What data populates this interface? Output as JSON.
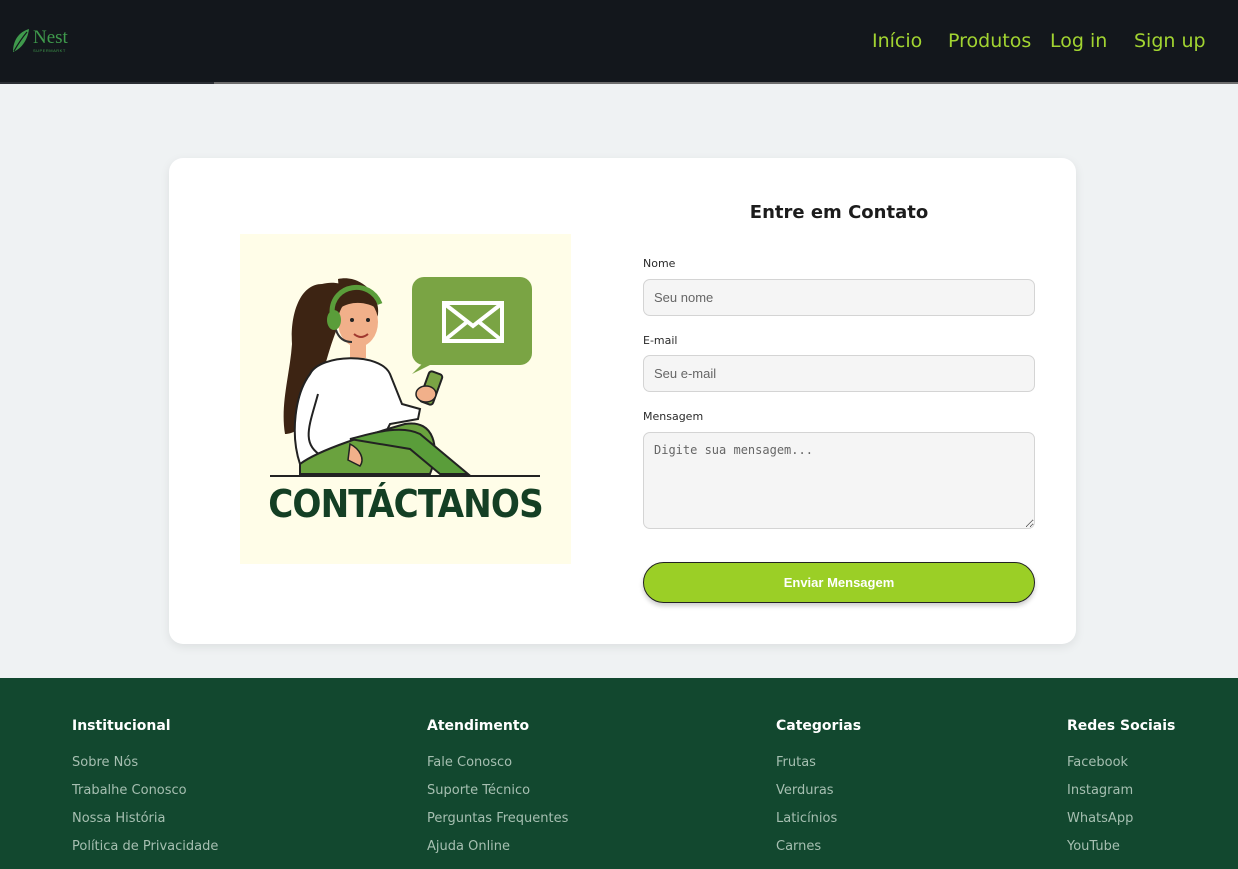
{
  "brand": {
    "name": "Nest",
    "tagline": "SUPERMARKT",
    "color": "#3f9a4c"
  },
  "nav": {
    "links": [
      {
        "label": "Início"
      },
      {
        "label": "Produtos"
      },
      {
        "label": "Log in"
      },
      {
        "label": "Sign up"
      }
    ],
    "link_color": "#a2d431"
  },
  "contact": {
    "illustration_text": "CONTÁCTANOS",
    "title": "Entre em Contato",
    "name_label": "Nome",
    "name_placeholder": "Seu nome",
    "email_label": "E-mail",
    "email_placeholder": "Seu e-mail",
    "message_label": "Mensagem",
    "message_placeholder": "Digite sua mensagem...",
    "submit_label": "Enviar Mensagem",
    "accent": "#9bcf26"
  },
  "footer": {
    "background": "#12482f",
    "columns": [
      {
        "title": "Institucional",
        "links": [
          "Sobre Nós",
          "Trabalhe Conosco",
          "Nossa História",
          "Política de Privacidade"
        ]
      },
      {
        "title": "Atendimento",
        "links": [
          "Fale Conosco",
          "Suporte Técnico",
          "Perguntas Frequentes",
          "Ajuda Online"
        ]
      },
      {
        "title": "Categorias",
        "links": [
          "Frutas",
          "Verduras",
          "Laticínios",
          "Carnes"
        ]
      },
      {
        "title": "Redes Sociais",
        "links": [
          "Facebook",
          "Instagram",
          "WhatsApp",
          "YouTube"
        ]
      }
    ]
  }
}
